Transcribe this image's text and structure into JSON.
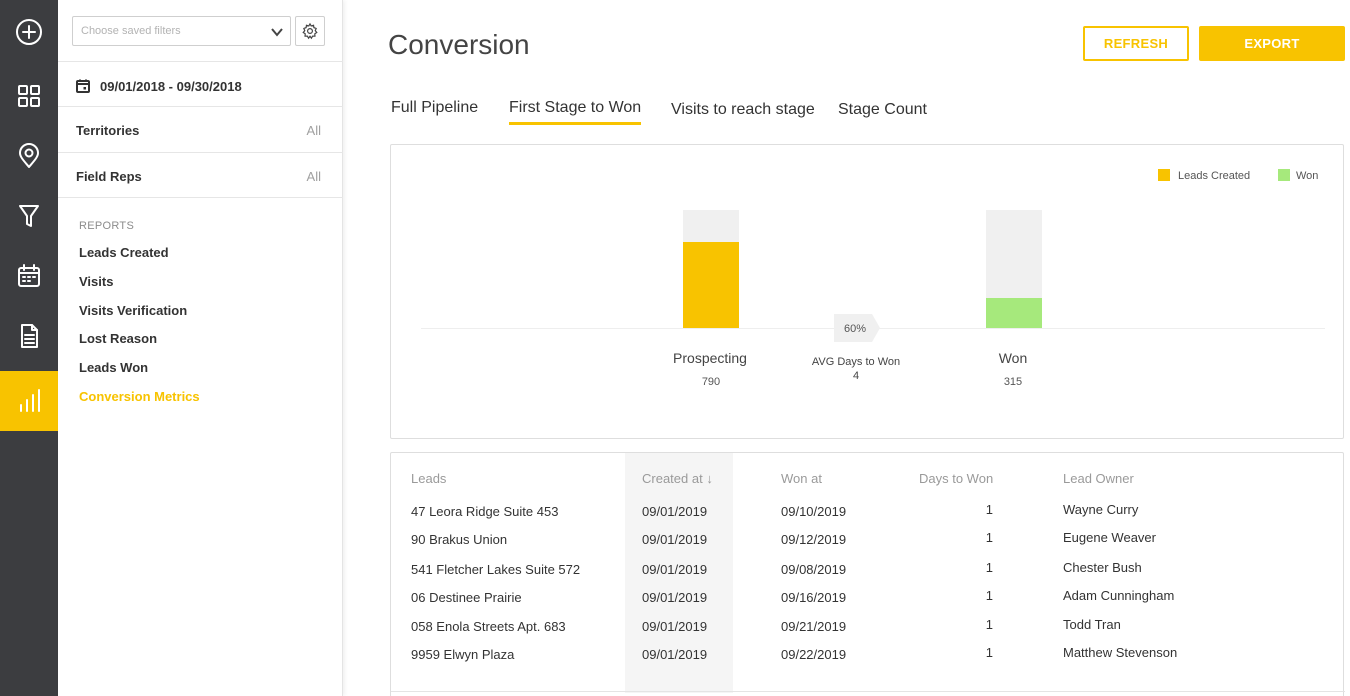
{
  "sidebar": {
    "saved_filters_placeholder": "Choose saved filters",
    "date_range": "09/01/2018 - 09/30/2018",
    "territories": {
      "label": "Territories",
      "value": "All"
    },
    "field_reps": {
      "label": "Field Reps",
      "value": "All"
    },
    "reports_title": "REPORTS",
    "reports": [
      "Leads Created",
      "Visits",
      "Visits Verification",
      "Lost Reason",
      "Leads Won",
      "Conversion Metrics"
    ],
    "active_report": "Conversion Metrics"
  },
  "rail": {
    "icons": [
      "plus-circle-icon",
      "dashboard-grid-icon",
      "map-pin-icon",
      "funnel-icon",
      "calendar-icon",
      "document-icon",
      "bar-chart-icon"
    ],
    "active": "bar-chart-icon"
  },
  "header": {
    "title": "Conversion",
    "refresh_label": "REFRESH",
    "export_label": "EXPORT"
  },
  "tabs": [
    {
      "label": "Full Pipeline"
    },
    {
      "label": "First Stage to Won"
    },
    {
      "label": "Visits to reach stage"
    },
    {
      "label": "Stage Count"
    }
  ],
  "active_tab": "First Stage to Won",
  "chart_data": {
    "type": "bar",
    "legend": [
      "Leads Created",
      "Won"
    ],
    "legend_position": "top-right",
    "colors": {
      "leads_created": "#f8c300",
      "won": "#a6e97c",
      "track": "#f0f0f0"
    },
    "ylim": [
      0,
      1
    ],
    "stages": [
      {
        "name": "Prospecting",
        "count": "790",
        "fill": 0.73,
        "series": "Leads Created"
      },
      {
        "name": "Won",
        "count": "315",
        "fill": 0.25,
        "series": "Won"
      }
    ],
    "conversion_rate": "60%",
    "avg_days_label": "AVG Days to Won",
    "avg_days_value": "4"
  },
  "table": {
    "columns": [
      "Leads",
      "Created at ↓",
      "Won at",
      "Days to Won",
      "Lead Owner"
    ],
    "rows": [
      [
        "47 Leora Ridge Suite 453",
        "09/01/2019",
        "09/10/2019",
        "1",
        "Wayne Curry"
      ],
      [
        "90 Brakus Union",
        "09/01/2019",
        "09/12/2019",
        "1",
        "Eugene Weaver"
      ],
      [
        "541 Fletcher Lakes Suite 572",
        "09/01/2019",
        "09/08/2019",
        "1",
        "Chester Bush"
      ],
      [
        "06 Destinee Prairie",
        "09/01/2019",
        "09/16/2019",
        "1",
        "Adam Cunningham"
      ],
      [
        "058 Enola Streets Apt. 683",
        "09/01/2019",
        "09/21/2019",
        "1",
        "Todd Tran"
      ],
      [
        "9959 Elwyn Plaza",
        "09/01/2019",
        "09/22/2019",
        "1",
        "Matthew Stevenson"
      ]
    ]
  }
}
